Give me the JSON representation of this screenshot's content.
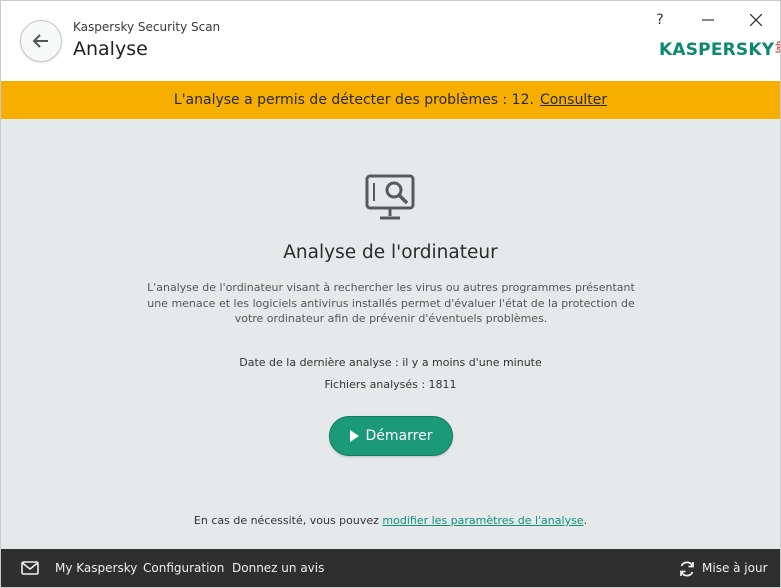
{
  "header": {
    "app_name": "Kaspersky Security Scan",
    "title": "Analyse",
    "help_label": "?",
    "logo_text": "KASPERSKY",
    "logo_sub": "lab"
  },
  "alert": {
    "text": "L'analyse a permis de détecter des problèmes : 12.",
    "link": "Consulter"
  },
  "main": {
    "section_title": "Analyse de l'ordinateur",
    "description": "L'analyse de l'ordinateur visant à rechercher les virus ou autres programmes présentant une menace et les logiciels antivirus installés permet d'évaluer l'état de la protection de votre ordinateur afin de prévenir d'éventuels problèmes.",
    "last_scan": "Date de la dernière analyse : il y a moins d'une minute",
    "files_scanned": "Fichiers analysés : 1811",
    "start_button": "Démarrer",
    "settings_prefix": "En cas de nécessité, vous pouvez",
    "settings_link": "modifier les paramètres de l'analyse",
    "settings_suffix": "."
  },
  "bottom_bar": {
    "my_kaspersky": "My Kaspersky",
    "configuration": "Configuration",
    "feedback": "Donnez un avis",
    "update": "Mise à jour"
  },
  "colors": {
    "accent_green": "#1a9a79",
    "alert_orange": "#f6ae00",
    "footer_dark": "#2f2f30"
  }
}
